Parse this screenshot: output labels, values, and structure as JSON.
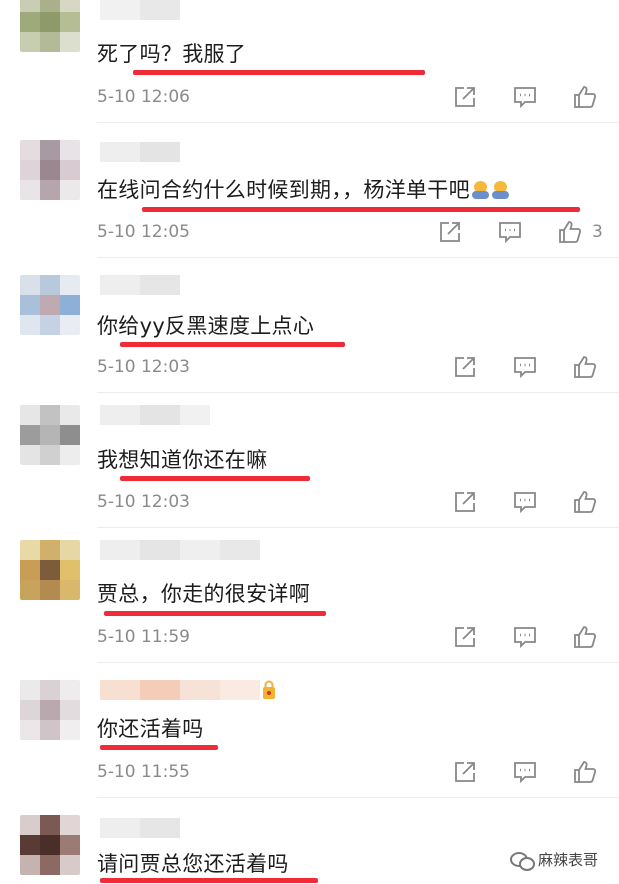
{
  "comments": [
    {
      "text": "死了吗？我服了",
      "time": "5-10 12:06",
      "likes": ""
    },
    {
      "text": "在线问合约什么时候到期，，杨洋单干吧",
      "time": "5-10 12:05",
      "likes": "3"
    },
    {
      "text": "你给yy反黑速度上点心",
      "time": "5-10 12:03",
      "likes": ""
    },
    {
      "text": "我想知道你还在嘛",
      "time": "5-10 12:03",
      "likes": ""
    },
    {
      "text": "贾总，你走的很安详啊",
      "time": "5-10 11:59",
      "likes": ""
    },
    {
      "text": "你还活着吗",
      "time": "5-10 11:55",
      "likes": ""
    },
    {
      "text": "请问贾总您还活着吗",
      "time": "",
      "likes": ""
    }
  ],
  "icons": {
    "share": "share-icon",
    "comment": "comment-icon",
    "like": "thumbs-up-icon",
    "emoji": "crying-emoji-icon"
  },
  "watermark": {
    "text": "麻辣表哥"
  },
  "colors": {
    "highlight": "#ee2b36",
    "muted": "#8a8a8a",
    "text": "#1c1c1c"
  }
}
